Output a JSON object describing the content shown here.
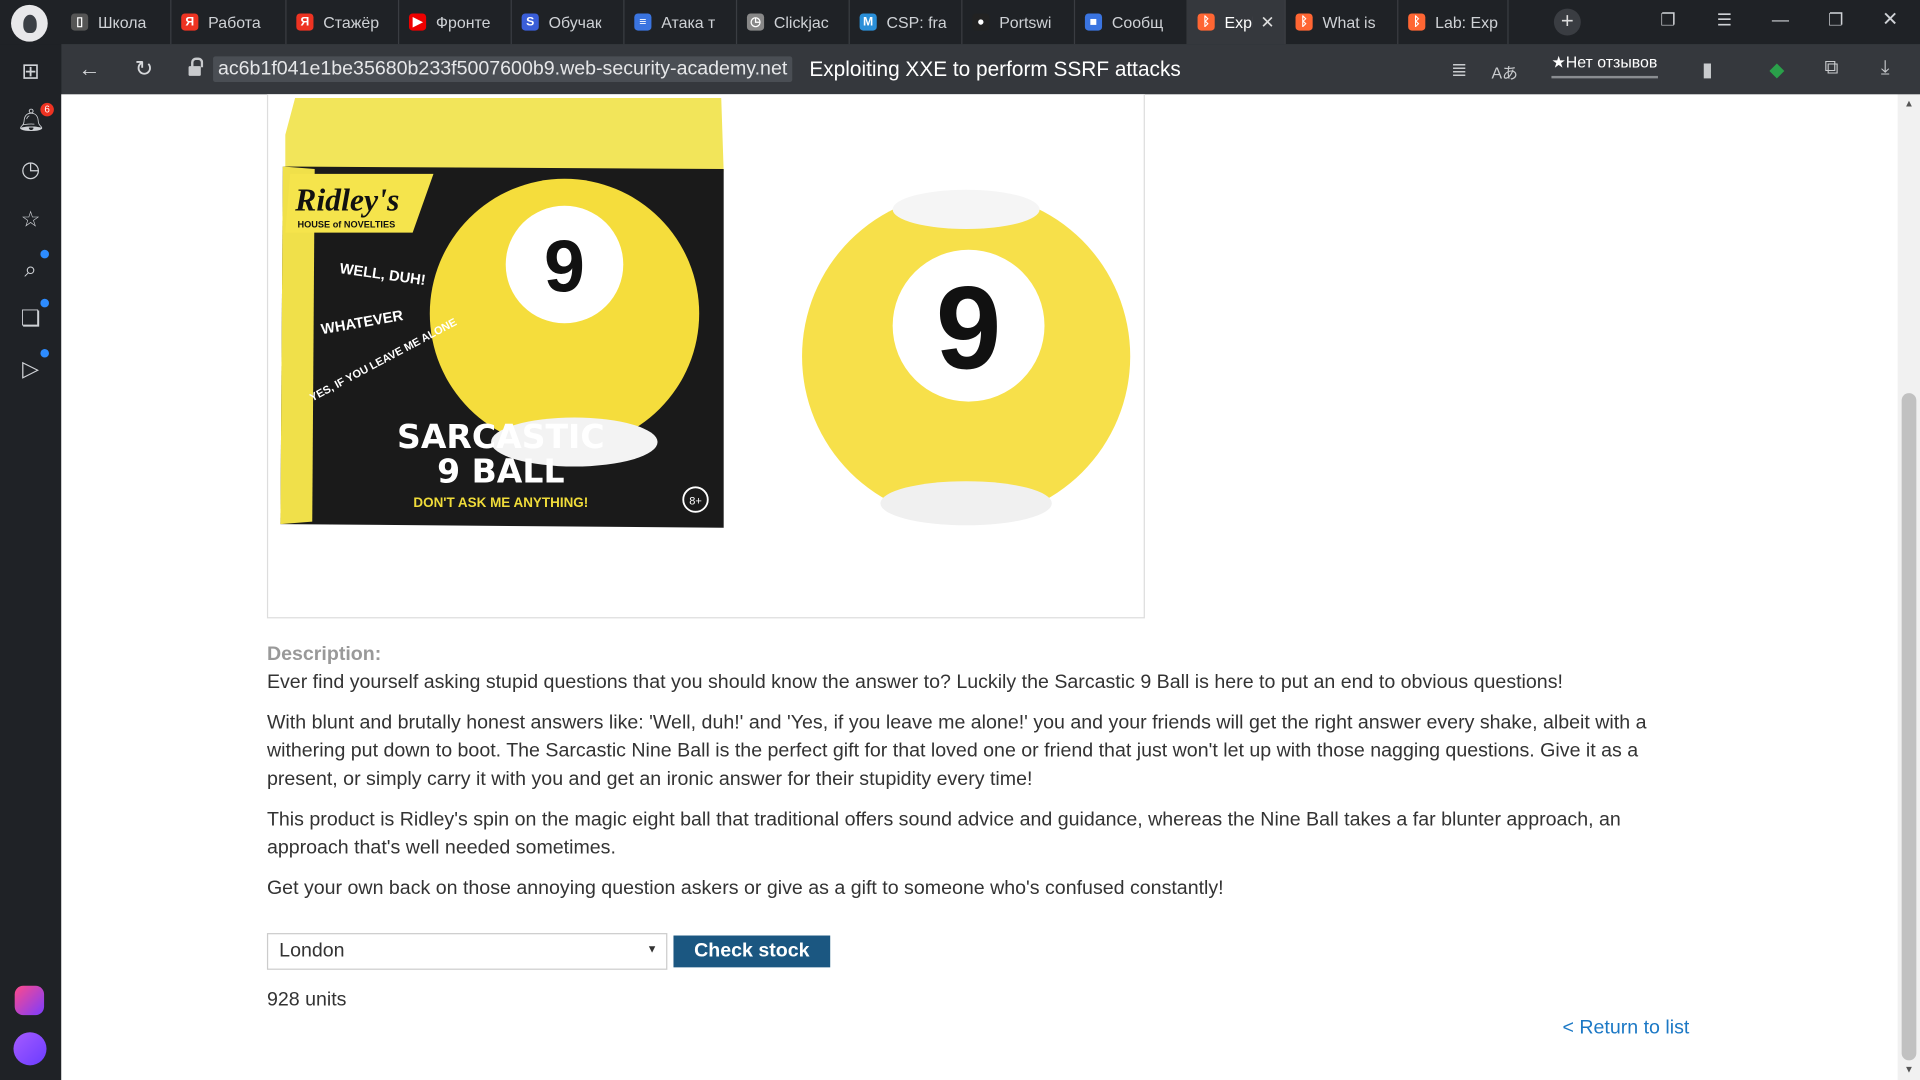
{
  "browser": {
    "tabs": [
      {
        "title": "Школа",
        "icon": "page-icon",
        "color": "#555"
      },
      {
        "title": "Работа",
        "icon": "yandex-icon",
        "color": "#e32"
      },
      {
        "title": "Стажёр",
        "icon": "yandex-icon",
        "color": "#e32"
      },
      {
        "title": "Фронте",
        "icon": "youtube-icon",
        "color": "#e00"
      },
      {
        "title": "Обучак",
        "icon": "s-icon",
        "color": "#3a5ed8"
      },
      {
        "title": "Атака т",
        "icon": "doc-icon",
        "color": "#3a74e0"
      },
      {
        "title": "Clickjac",
        "icon": "clock-icon",
        "color": "#888"
      },
      {
        "title": "CSP: fra",
        "icon": "mdn-icon",
        "color": "#2a8fd8"
      },
      {
        "title": "Portswi",
        "icon": "github-icon",
        "color": "#222"
      },
      {
        "title": "Сообщ",
        "icon": "chat-icon",
        "color": "#3a74e0"
      },
      {
        "title": "Explo",
        "icon": "portswigger-icon",
        "color": "#ff6633",
        "active": true
      },
      {
        "title": "What is",
        "icon": "portswigger-icon",
        "color": "#ff6633"
      },
      {
        "title": "Lab: Exp",
        "icon": "portswigger-icon",
        "color": "#ff6633"
      }
    ],
    "url": "ac6b1f041e1be35680b233f5007600b9.web-security-academy.net",
    "page_title": "Exploiting XXE to perform SSRF attacks",
    "review_label": "★Нет отзывов",
    "notification_count": "6"
  },
  "product": {
    "box_brand": "Ridley's",
    "box_brand_sub": "HOUSE of NOVELTIES",
    "box_line1": "WELL, DUH!",
    "box_line2": "WHATEVER",
    "box_line3": "YES, IF YOU LEAVE ME ALONE",
    "box_title1": "SARCASTIC",
    "box_title2": "9 BALL",
    "box_tagline": "DON'T ASK ME ANYTHING!",
    "box_age": "8+",
    "ball_number": "9",
    "description_label": "Description:",
    "paragraphs": [
      "Ever find yourself asking stupid questions that you should know the answer to? Luckily the Sarcastic 9 Ball is here to put an end to obvious questions!",
      "With blunt and brutally honest answers like: 'Well, duh!' and 'Yes, if you leave me alone!' you and your friends will get the right answer every shake, albeit with a withering put down to boot. The Sarcastic Nine Ball is the perfect gift for that loved one or friend that just won't let up with those nagging questions. Give it as a present, or simply carry it with you and get an ironic answer for their stupidity every time!",
      "This product is Ridley's spin on the magic eight ball that traditional offers sound advice and guidance, whereas the Nine Ball takes a far blunter approach, an approach that's well needed sometimes.",
      "Get your own back on those annoying question askers or give as a gift to someone who's confused constantly!"
    ],
    "store_select": "London",
    "check_stock_label": "Check stock",
    "stock_result": "928 units",
    "return_link": "< Return to list"
  },
  "colors": {
    "button": "#1b5781",
    "link": "#1b78c5",
    "ball": "#f7e04a"
  }
}
